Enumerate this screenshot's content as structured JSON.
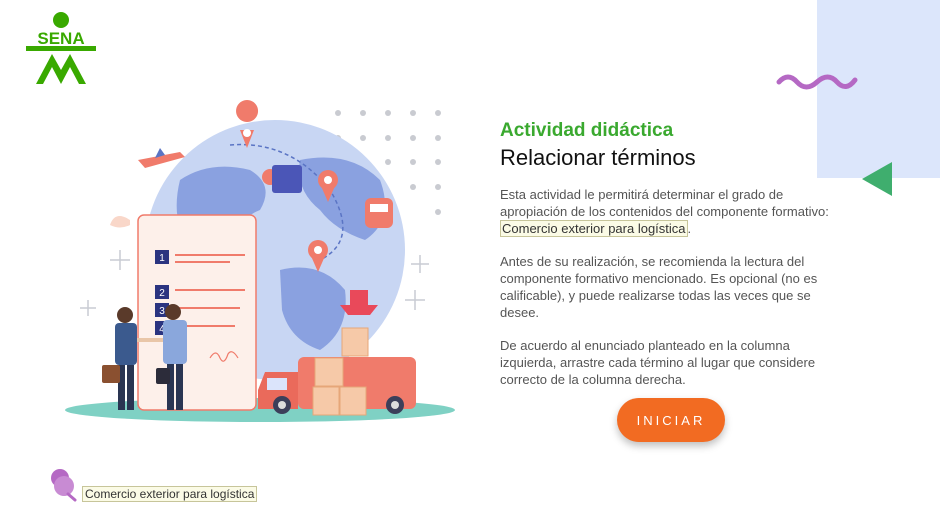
{
  "brand": {
    "name": "SENA",
    "color": "#39a900",
    "icon": "sena-logo"
  },
  "activity": {
    "subtitle": "Actividad didáctica",
    "title": "Relacionar términos",
    "description_before": "Esta actividad le permitirá determinar el grado de apropiación de los contenidos del componente formativo: ",
    "component_name": "Comercio exterior para logística",
    "description_after": ".",
    "recommendation": "Antes de su realización, se recomienda la lectura del componente formativo mencionado. Es opcional (no es calificable), y puede realizarse todas las veces que se desee.",
    "instructions": "De acuerdo al enunciado planteado en la columna izquierda, arrastre cada término al lugar que considere correcto de la columna derecha."
  },
  "buttons": {
    "start_label": "INICIAR"
  },
  "footer": {
    "label": "Comercio exterior para logística",
    "icon": "pin-icon"
  },
  "illustration": {
    "icon": "logistics-illustration",
    "list_numbers": [
      "1",
      "2",
      "3",
      "4"
    ]
  },
  "colors": {
    "accent_green": "#3aa92f",
    "button_orange": "#f26b22",
    "deco_blue": "#dce6fb",
    "deco_purple": "#b569c4",
    "deco_teal": "#3fae6e"
  }
}
